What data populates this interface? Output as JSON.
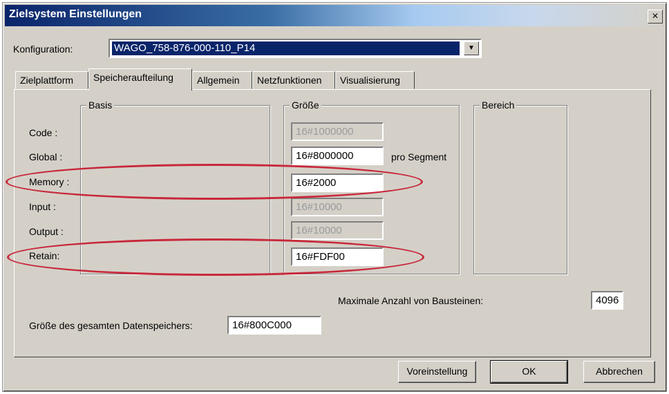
{
  "window": {
    "title": "Zielsystem Einstellungen",
    "close_glyph": "×"
  },
  "config": {
    "label": "Konfiguration:",
    "selected": "WAGO_758-876-000-110_P14",
    "dropdown_glyph": "▼"
  },
  "tabs": [
    {
      "label": "Zielplattform",
      "active": false
    },
    {
      "label": "Speicheraufteilung",
      "active": true
    },
    {
      "label": "Allgemein",
      "active": false
    },
    {
      "label": "Netzfunktionen",
      "active": false
    },
    {
      "label": "Visualisierung",
      "active": false
    }
  ],
  "groups": {
    "basis": "Basis",
    "groesse": "Größe",
    "bereich": "Bereich"
  },
  "rows": {
    "code": {
      "label": "Code :",
      "value": "16#1000000",
      "enabled": false
    },
    "global": {
      "label": "Global :",
      "value": "16#8000000",
      "enabled": true
    },
    "memory": {
      "label": "Memory :",
      "value": "16#2000",
      "enabled": true
    },
    "input": {
      "label": "Input :",
      "value": "16#10000",
      "enabled": false
    },
    "output": {
      "label": "Output :",
      "value": "16#10000",
      "enabled": false
    },
    "retain": {
      "label": "Retain:",
      "value": "16#FDF00",
      "enabled": true
    }
  },
  "pro_segment": "pro Segment",
  "max_blocks": {
    "label": "Maximale Anzahl von Bausteinen:",
    "value": "4096"
  },
  "total_memory": {
    "label": "Größe des gesamten Datenspeichers:",
    "value": "16#800C000"
  },
  "buttons": {
    "defaults": "Voreinstellung",
    "ok": "OK",
    "cancel": "Abbrechen"
  },
  "colors": {
    "title_gradient_start": "#0a246a",
    "highlight_oval": "#c8283a",
    "dialog_bg": "#d4d0c8"
  }
}
